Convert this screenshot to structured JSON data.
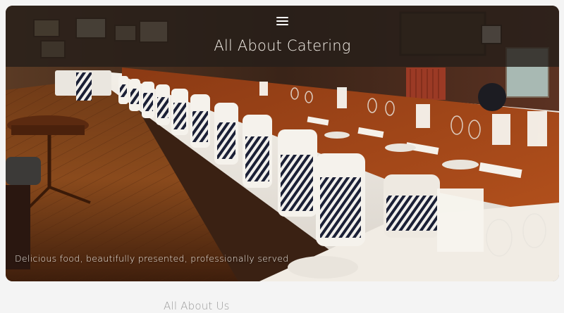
{
  "site": {
    "title": "All About Catering",
    "tagline": "Delicious food, beautifully presented, professionally served"
  },
  "nav": {
    "menu_icon": "hamburger-menu-icon"
  },
  "hero": {
    "image": "banquet-hall-long-table-photo"
  },
  "sections": {
    "about_heading": "All About Us"
  },
  "colors": {
    "page_background": "#f4f4f4",
    "overlay": "#261e1a",
    "title_text": "#f4efe8",
    "heading_text": "#9a9a9a"
  }
}
